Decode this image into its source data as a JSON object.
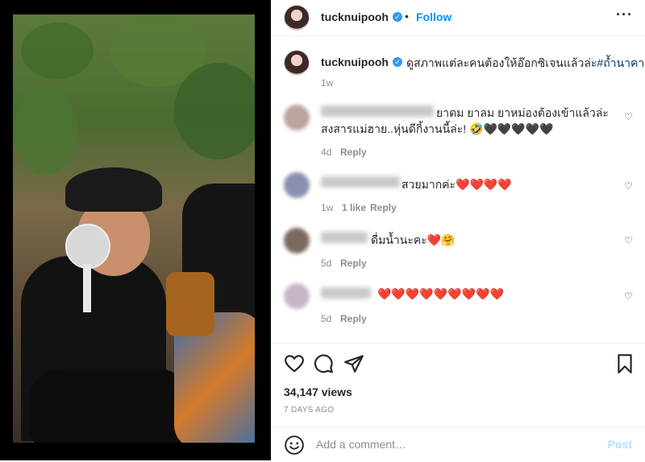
{
  "post": {
    "username": "tucknuipooh",
    "follow_label": "Follow",
    "separator": "•",
    "more_icon": "more-options-icon"
  },
  "caption": {
    "username": "tucknuipooh",
    "text": "ดูสภาพแต่ละคนต้องให้อ๊อกซิเจนแล้วล่ะ",
    "hashtag": "#ถ้ำนาคา",
    "time": "1w"
  },
  "comments": [
    {
      "line1": "ยาดม ยาลม ยาหม่องต้องเข้าแล้วล่ะ",
      "line2": "สงสารแม่ฮาย..หุ่นดีกิ้งานนี้ล่ะ! 🤣🖤🖤🖤🖤🖤",
      "time": "4d",
      "likes": "",
      "reply": "Reply"
    },
    {
      "line1": "สวยมากค่ะ❤️❤️❤️❤️",
      "line2": "",
      "time": "1w",
      "likes": "1 like",
      "reply": "Reply"
    },
    {
      "line1": "ดื่มน้ำนะคะ❤️🤗",
      "line2": "",
      "time": "5d",
      "likes": "",
      "reply": "Reply"
    },
    {
      "line1": "❤️❤️❤️❤️❤️❤️❤️❤️❤️",
      "line2": "",
      "time": "5d",
      "likes": "",
      "reply": "Reply"
    }
  ],
  "stats": {
    "views": "34,147 views",
    "date": "7 DAYS AGO"
  },
  "add_comment": {
    "placeholder": "Add a comment…",
    "post_label": "Post"
  },
  "colors": {
    "link": "#0095f6",
    "hashtag": "#00376b",
    "muted": "#8e8e8e",
    "post_disabled": "#b3dbff"
  }
}
